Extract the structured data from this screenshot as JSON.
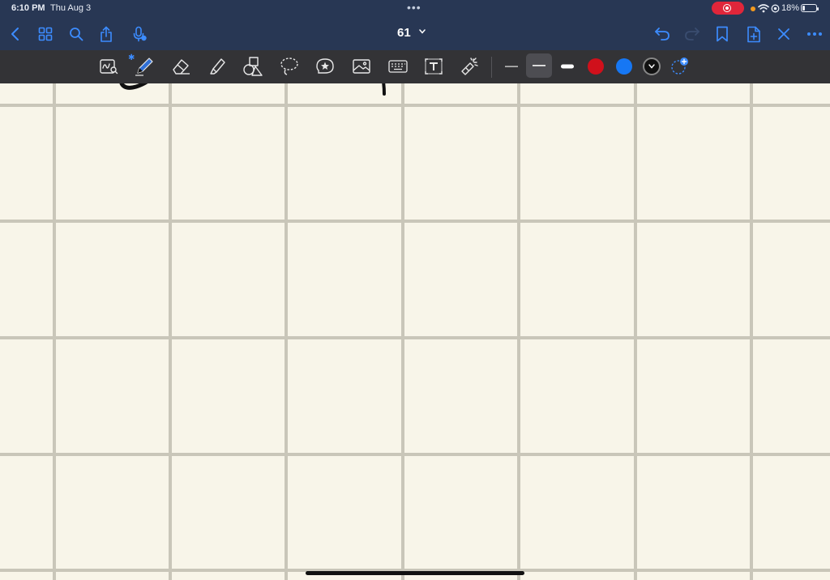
{
  "status_bar": {
    "time": "6:10 PM",
    "date": "Thu Aug 3",
    "multitask_indicator": "•••",
    "battery_percent": "18%",
    "icons": [
      "screen-record-icon",
      "orange-dot-indicator",
      "wifi-icon",
      "location-icon",
      "battery-icon"
    ]
  },
  "nav": {
    "page_number": "61",
    "left_icons": [
      "back-chevron-icon",
      "thumbnails-grid-icon",
      "search-icon",
      "share-icon",
      "microphone-icon"
    ],
    "right_icons": [
      "undo-icon",
      "redo-icon",
      "bookmark-icon",
      "add-page-icon",
      "close-icon",
      "more-icon"
    ]
  },
  "toolbar": {
    "tools": [
      "handwriting-search-icon",
      "pen-icon",
      "eraser-icon",
      "highlighter-icon",
      "shapes-icon",
      "lasso-icon",
      "elements-icon",
      "image-icon",
      "keyboard-icon",
      "text-box-icon",
      "laser-pointer-icon"
    ],
    "active_tool": "pen-icon",
    "stroke_widths": [
      "thin",
      "medium",
      "thick"
    ],
    "selected_width": "medium",
    "colors": {
      "red": "#d0101b",
      "blue": "#1677f4",
      "black": "#111111"
    },
    "selected_color": "black"
  },
  "canvas": {
    "paper_color": "#f8f5e9",
    "grid_color": "#c9c6b9",
    "background": "grid"
  }
}
